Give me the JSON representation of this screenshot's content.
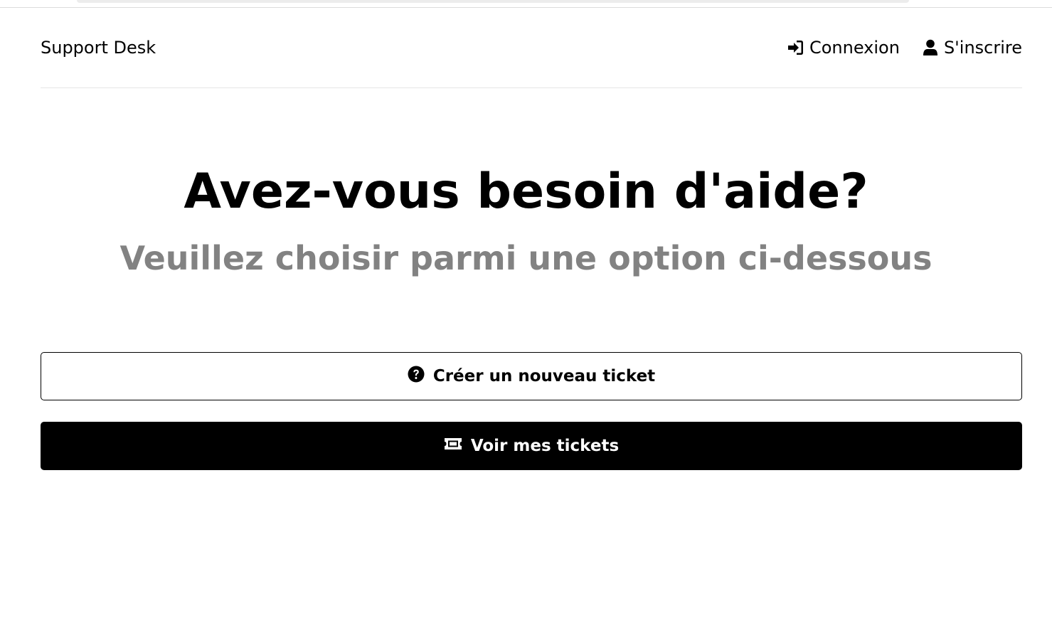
{
  "header": {
    "logo": "Support Desk",
    "nav": {
      "login_label": "Connexion",
      "login_icon": "sign-in-icon",
      "register_label": "S'inscrire",
      "register_icon": "user-icon"
    }
  },
  "hero": {
    "title": "Avez-vous besoin d'aide?",
    "subtitle": "Veuillez choisir parmi une option ci-dessous"
  },
  "actions": {
    "new_ticket_label": "Créer un nouveau ticket",
    "new_ticket_icon": "question-circle-icon",
    "view_tickets_label": "Voir mes tickets",
    "view_tickets_icon": "ticket-icon"
  },
  "colors": {
    "primary": "#000000",
    "subtitle": "#828282",
    "background": "#ffffff"
  }
}
